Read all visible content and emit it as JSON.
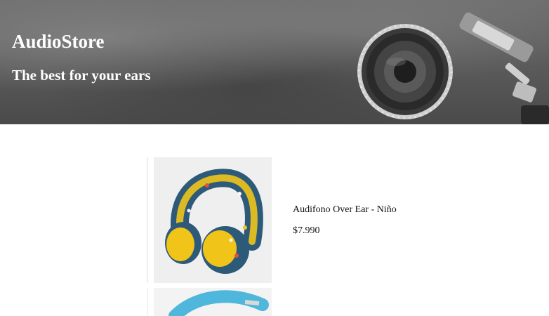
{
  "header": {
    "title": "AudioStore",
    "subtitle": "The best for your ears"
  },
  "products": [
    {
      "name": "Audifono Over Ear - Niño",
      "price": "$7.990",
      "image_icon": "kids-headphones-image"
    },
    {
      "image_icon": "blue-headphones-image"
    }
  ],
  "colors": {
    "hero_text": "#ffffff",
    "body_text": "#111111",
    "headphone_band": "#2e5a7a",
    "headphone_cushion": "#f0c419",
    "second_headphone": "#4fb6dc"
  }
}
